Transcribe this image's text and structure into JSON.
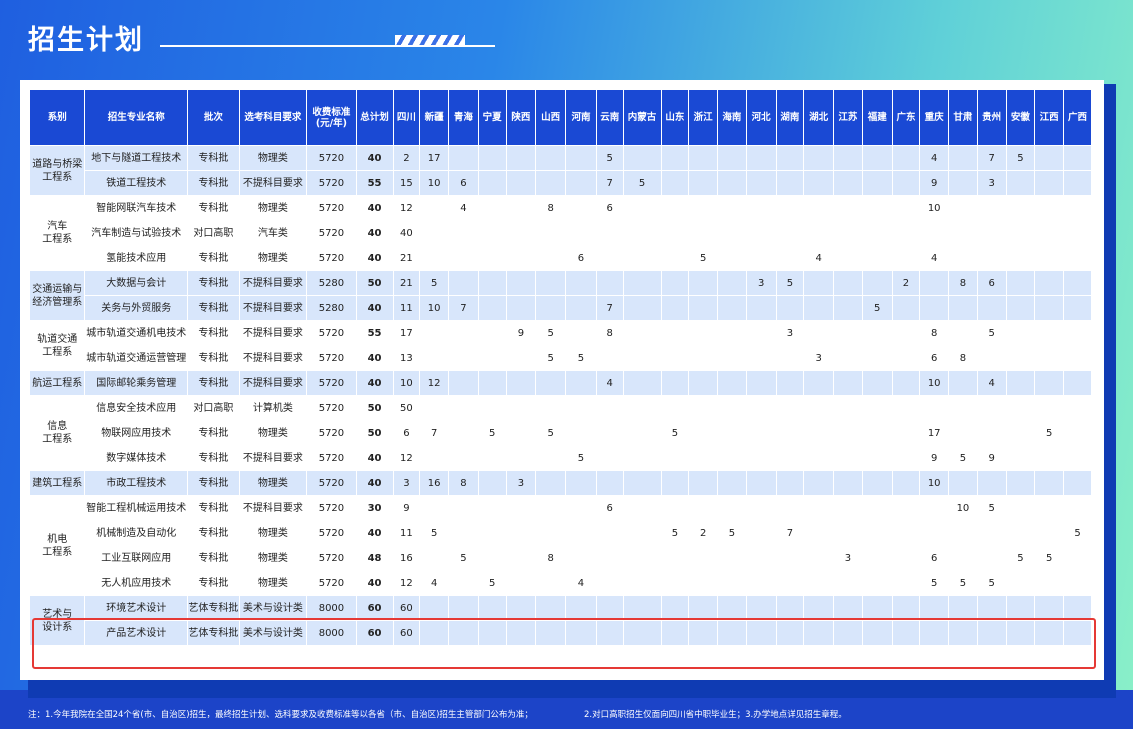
{
  "page": {
    "title": "招生计划"
  },
  "table": {
    "headers": [
      "系别",
      "招生专业名称",
      "批次",
      "选考科目要求",
      "收费标准\n(元/年)",
      "总计划",
      "四川",
      "新疆",
      "青海",
      "宁夏",
      "陕西",
      "山西",
      "河南",
      "云南",
      "内蒙古",
      "山东",
      "浙江",
      "海南",
      "河北",
      "湖南",
      "湖北",
      "江苏",
      "福建",
      "广东",
      "重庆",
      "甘肃",
      "贵州",
      "安徽",
      "江西",
      "广西"
    ],
    "groups": [
      {
        "name": "道路与桥梁\n工程系",
        "rows": [
          [
            "地下与隧道工程技术",
            "专科批",
            "物理类",
            "5720",
            "40",
            "2",
            "17",
            "",
            "",
            "",
            "",
            "",
            "5",
            "",
            "",
            "",
            "",
            "",
            "",
            "",
            "",
            "",
            "",
            "4",
            "",
            "7",
            "5",
            "",
            ""
          ],
          [
            "铁道工程技术",
            "专科批",
            "不提科目要求",
            "5720",
            "55",
            "15",
            "10",
            "6",
            "",
            "",
            "",
            "",
            "7",
            "5",
            "",
            "",
            "",
            "",
            "",
            "",
            "",
            "",
            "",
            "9",
            "",
            "3",
            "",
            "",
            ""
          ]
        ]
      },
      {
        "name": "汽车\n工程系",
        "rows": [
          [
            "智能网联汽车技术",
            "专科批",
            "物理类",
            "5720",
            "40",
            "12",
            "",
            "4",
            "",
            "",
            "8",
            "",
            "6",
            "",
            "",
            "",
            "",
            "",
            "",
            "",
            "",
            "",
            "",
            "10",
            "",
            "",
            "",
            "",
            ""
          ],
          [
            "汽车制造与试验技术",
            "对口高职",
            "汽车类",
            "5720",
            "40",
            "40",
            "",
            "",
            "",
            "",
            "",
            "",
            "",
            "",
            "",
            "",
            "",
            "",
            "",
            "",
            "",
            "",
            "",
            "",
            "",
            "",
            "",
            "",
            ""
          ],
          [
            "氢能技术应用",
            "专科批",
            "物理类",
            "5720",
            "40",
            "21",
            "",
            "",
            "",
            "",
            "",
            "6",
            "",
            "",
            "",
            "5",
            "",
            "",
            "",
            "4",
            "",
            "",
            "",
            "4",
            "",
            "",
            "",
            "",
            ""
          ]
        ]
      },
      {
        "name": "交通运输与\n经济管理系",
        "rows": [
          [
            "大数据与会计",
            "专科批",
            "不提科目要求",
            "5280",
            "50",
            "21",
            "5",
            "",
            "",
            "",
            "",
            "",
            "",
            "",
            "",
            "",
            "",
            "3",
            "5",
            "",
            "",
            "",
            "2",
            "",
            "8",
            "6",
            "",
            "",
            ""
          ],
          [
            "关务与外贸服务",
            "专科批",
            "不提科目要求",
            "5280",
            "40",
            "11",
            "10",
            "7",
            "",
            "",
            "",
            "",
            "7",
            "",
            "",
            "",
            "",
            "",
            "",
            "",
            "",
            "5",
            "",
            "",
            "",
            "",
            "",
            "",
            ""
          ]
        ]
      },
      {
        "name": "轨道交通\n工程系",
        "rows": [
          [
            "城市轨道交通机电技术",
            "专科批",
            "不提科目要求",
            "5720",
            "55",
            "17",
            "",
            "",
            "",
            "9",
            "5",
            "",
            "8",
            "",
            "",
            "",
            "",
            "",
            "3",
            "",
            "",
            "",
            "",
            "8",
            "",
            "5",
            "",
            "",
            ""
          ],
          [
            "城市轨道交通运营管理",
            "专科批",
            "不提科目要求",
            "5720",
            "40",
            "13",
            "",
            "",
            "",
            "",
            "5",
            "5",
            "",
            "",
            "",
            "",
            "",
            "",
            "",
            "3",
            "",
            "",
            "",
            "6",
            "8",
            "",
            "",
            "",
            ""
          ]
        ]
      },
      {
        "name": "航运工程系",
        "rows": [
          [
            "国际邮轮乘务管理",
            "专科批",
            "不提科目要求",
            "5720",
            "40",
            "10",
            "12",
            "",
            "",
            "",
            "",
            "",
            "4",
            "",
            "",
            "",
            "",
            "",
            "",
            "",
            "",
            "",
            "",
            "10",
            "",
            "4",
            "",
            "",
            ""
          ]
        ]
      },
      {
        "name": "信息\n工程系",
        "rows": [
          [
            "信息安全技术应用",
            "对口高职",
            "计算机类",
            "5720",
            "50",
            "50",
            "",
            "",
            "",
            "",
            "",
            "",
            "",
            "",
            "",
            "",
            "",
            "",
            "",
            "",
            "",
            "",
            "",
            "",
            "",
            "",
            "",
            "",
            ""
          ],
          [
            "物联网应用技术",
            "专科批",
            "物理类",
            "5720",
            "50",
            "6",
            "7",
            "",
            "5",
            "",
            "5",
            "",
            "",
            "",
            "5",
            "",
            "",
            "",
            "",
            "",
            "",
            "",
            "",
            "17",
            "",
            "",
            "",
            "5",
            ""
          ],
          [
            "数字媒体技术",
            "专科批",
            "不提科目要求",
            "5720",
            "40",
            "12",
            "",
            "",
            "",
            "",
            "",
            "5",
            "",
            "",
            "",
            "",
            "",
            "",
            "",
            "",
            "",
            "",
            "",
            "9",
            "5",
            "9",
            "",
            "",
            ""
          ]
        ]
      },
      {
        "name": "建筑工程系",
        "rows": [
          [
            "市政工程技术",
            "专科批",
            "物理类",
            "5720",
            "40",
            "3",
            "16",
            "8",
            "",
            "3",
            "",
            "",
            "",
            "",
            "",
            "",
            "",
            "",
            "",
            "",
            "",
            "",
            "",
            "10",
            "",
            "",
            "",
            "",
            ""
          ]
        ]
      },
      {
        "name": "机电\n工程系",
        "rows": [
          [
            "智能工程机械运用技术",
            "专科批",
            "不提科目要求",
            "5720",
            "30",
            "9",
            "",
            "",
            "",
            "",
            "",
            "",
            "6",
            "",
            "",
            "",
            "",
            "",
            "",
            "",
            "",
            "",
            "",
            "",
            "10",
            "5",
            "",
            "",
            ""
          ],
          [
            "机械制造及自动化",
            "专科批",
            "物理类",
            "5720",
            "40",
            "11",
            "5",
            "",
            "",
            "",
            "",
            "",
            "",
            "",
            "5",
            "2",
            "5",
            "",
            "7",
            "",
            "",
            "",
            "",
            "",
            "",
            "",
            "",
            "",
            "5"
          ],
          [
            "工业互联网应用",
            "专科批",
            "物理类",
            "5720",
            "48",
            "16",
            "",
            "5",
            "",
            "",
            "8",
            "",
            "",
            "",
            "",
            "",
            "",
            "",
            "",
            "",
            "3",
            "",
            "",
            "6",
            "",
            "",
            "5",
            "5",
            ""
          ],
          [
            "无人机应用技术",
            "专科批",
            "物理类",
            "5720",
            "40",
            "12",
            "4",
            "",
            "5",
            "",
            "",
            "4",
            "",
            "",
            "",
            "",
            "",
            "",
            "",
            "",
            "",
            "",
            "",
            "5",
            "5",
            "5",
            "",
            "",
            ""
          ]
        ]
      },
      {
        "name": "艺术与\n设计系",
        "rows": [
          [
            "环境艺术设计",
            "艺体专科批",
            "美术与设计类",
            "8000",
            "60",
            "60",
            "",
            "",
            "",
            "",
            "",
            "",
            "",
            "",
            "",
            "",
            "",
            "",
            "",
            "",
            "",
            "",
            "",
            "",
            "",
            "",
            "",
            "",
            ""
          ],
          [
            "产品艺术设计",
            "艺体专科批",
            "美术与设计类",
            "8000",
            "60",
            "60",
            "",
            "",
            "",
            "",
            "",
            "",
            "",
            "",
            "",
            "",
            "",
            "",
            "",
            "",
            "",
            "",
            "",
            "",
            "",
            "",
            "",
            "",
            ""
          ]
        ]
      }
    ]
  },
  "notes": {
    "left": "注：1.今年我院在全国24个省(市、自治区)招生，最终招生计划、选科要求及收费标准等以各省（市、自治区)招生主管部门公布为准；",
    "right": "2.对口高职招生仅面向四川省中职毕业生；3.办学地点详见招生章程。"
  }
}
